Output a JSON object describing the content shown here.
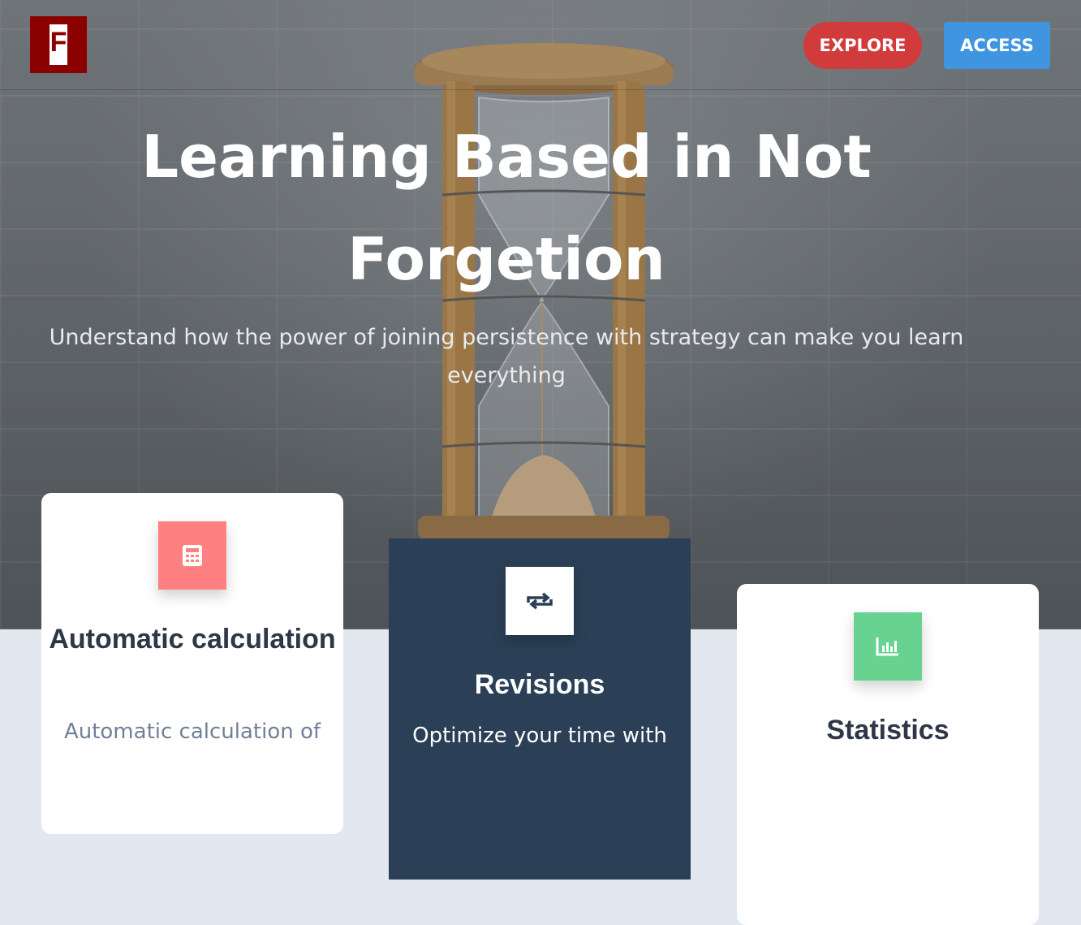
{
  "header": {
    "logo_letter": "F",
    "explore_label": "EXPLORE",
    "access_label": "ACCESS"
  },
  "hero": {
    "title": "Learning Based in Not Forgetion",
    "subtitle": "Understand how the power of joining persistence with strategy can make you learn everything"
  },
  "features": [
    {
      "icon": "calculator-icon",
      "title": "Automatic calculation",
      "text": "Automatic calculation of",
      "accent": "#ff8080"
    },
    {
      "icon": "repeat-icon",
      "title": "Revisions",
      "text": "Optimize your time with",
      "accent": "#ffffff"
    },
    {
      "icon": "bar-chart-icon",
      "title": "Statistics",
      "text": "",
      "accent": "#68d391"
    }
  ],
  "colors": {
    "logo_bg": "#8b0000",
    "explore_bg": "#d23b3b",
    "access_bg": "#3f95e0",
    "dark_card": "#2b3f56",
    "card_title": "#2d3748",
    "card_text": "#718096"
  }
}
